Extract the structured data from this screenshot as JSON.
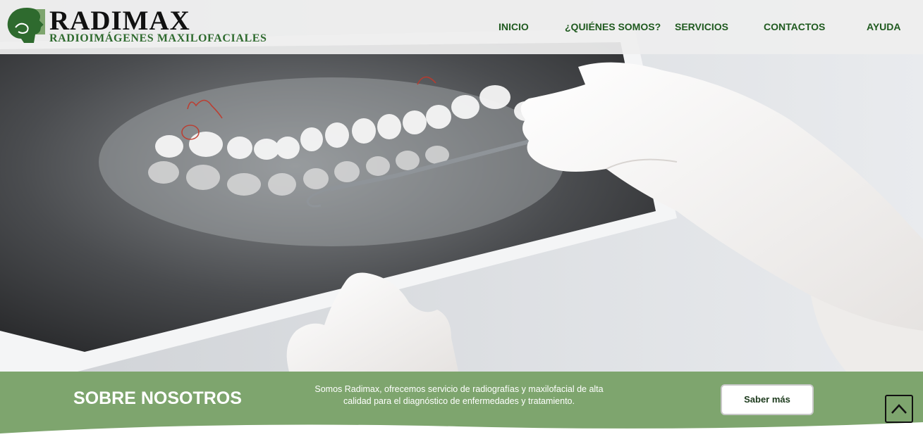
{
  "brand": {
    "title": "RADIMAX",
    "subtitle": "RADIOIMÁGENES MAXILOFACIALES",
    "green": "#2e6a2e"
  },
  "nav": {
    "items": [
      "INICIO",
      "¿QUIÉNES SOMOS?",
      "SERVICIOS",
      "CONTACTOS",
      "AYUDA"
    ],
    "color": "#1f5a1f"
  },
  "hero": {
    "image": "dental-xray-held-by-gloved-hands"
  },
  "about": {
    "title": "SOBRE NOSOTROS",
    "text_line1": "Somos Radimax, ofrecemos servicio de radiografías y maxilofacial de alta",
    "text_line2": "calidad para el diagnóstico de enfermedades y tratamiento.",
    "button_label": "Saber más",
    "background": "#7ea56e"
  },
  "scroll_top": {
    "icon": "chevron-up-icon"
  }
}
